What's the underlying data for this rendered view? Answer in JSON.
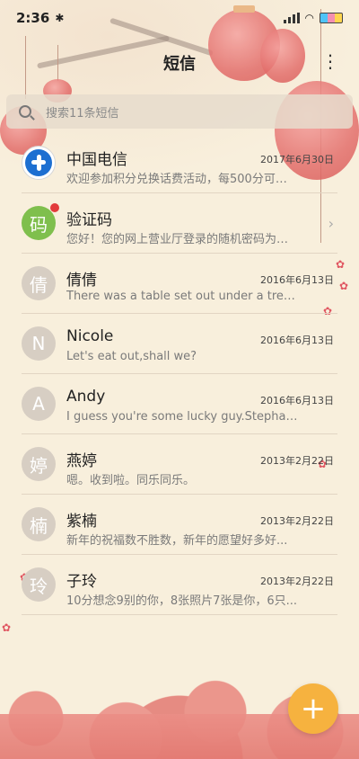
{
  "status_bar": {
    "time": "2:36",
    "bluetooth_icon": "bluetooth-icon",
    "signal_icon": "signal-icon",
    "battery_icon": "battery-icon"
  },
  "header": {
    "title": "短信",
    "more_icon": "more-vert-icon"
  },
  "search": {
    "placeholder": "搜索11条短信",
    "icon": "search-icon"
  },
  "conversations": [
    {
      "avatar_type": "logo",
      "avatar_text": "",
      "name": "中国电信",
      "date": "2017年6月30日",
      "preview": "欢迎参加积分兑换话费活动，每500分可兑..."
    },
    {
      "avatar_type": "green",
      "avatar_text": "码",
      "name": "验证码",
      "date": "",
      "preview": "您好！您的网上营业厅登录的随机密码为：...",
      "has_badge": true,
      "has_chevron": true
    },
    {
      "avatar_type": "default",
      "avatar_text": "倩",
      "name": "倩倩",
      "date": "2016年6月13日",
      "preview": "There was a table set out under a tree in..."
    },
    {
      "avatar_type": "default",
      "avatar_text": "N",
      "name": "Nicole",
      "date": "2016年6月13日",
      "preview": "Let's eat out,shall we?"
    },
    {
      "avatar_type": "default",
      "avatar_text": "A",
      "name": "Andy",
      "date": "2016年6月13日",
      "preview": "I guess you're some lucky guy.Stephani..."
    },
    {
      "avatar_type": "default",
      "avatar_text": "婷",
      "name": "燕婷",
      "date": "2013年2月22日",
      "preview": "嗯。收到啦。同乐同乐。"
    },
    {
      "avatar_type": "default",
      "avatar_text": "楠",
      "name": "紫楠",
      "date": "2013年2月22日",
      "preview": "新年的祝福数不胜数，新年的愿望好多好..."
    },
    {
      "avatar_type": "default",
      "avatar_text": "玲",
      "name": "子玲",
      "date": "2013年2月22日",
      "preview": "10分想念9别的你，8张照片7张是你，6只..."
    }
  ],
  "fab": {
    "label": "+",
    "icon": "add-icon"
  },
  "colors": {
    "background": "#f8efdc",
    "fab": "#f6b23f",
    "accent_red": "#e36e6b",
    "avatar_default": "#d7cec3",
    "avatar_green": "#7fbf4d"
  }
}
